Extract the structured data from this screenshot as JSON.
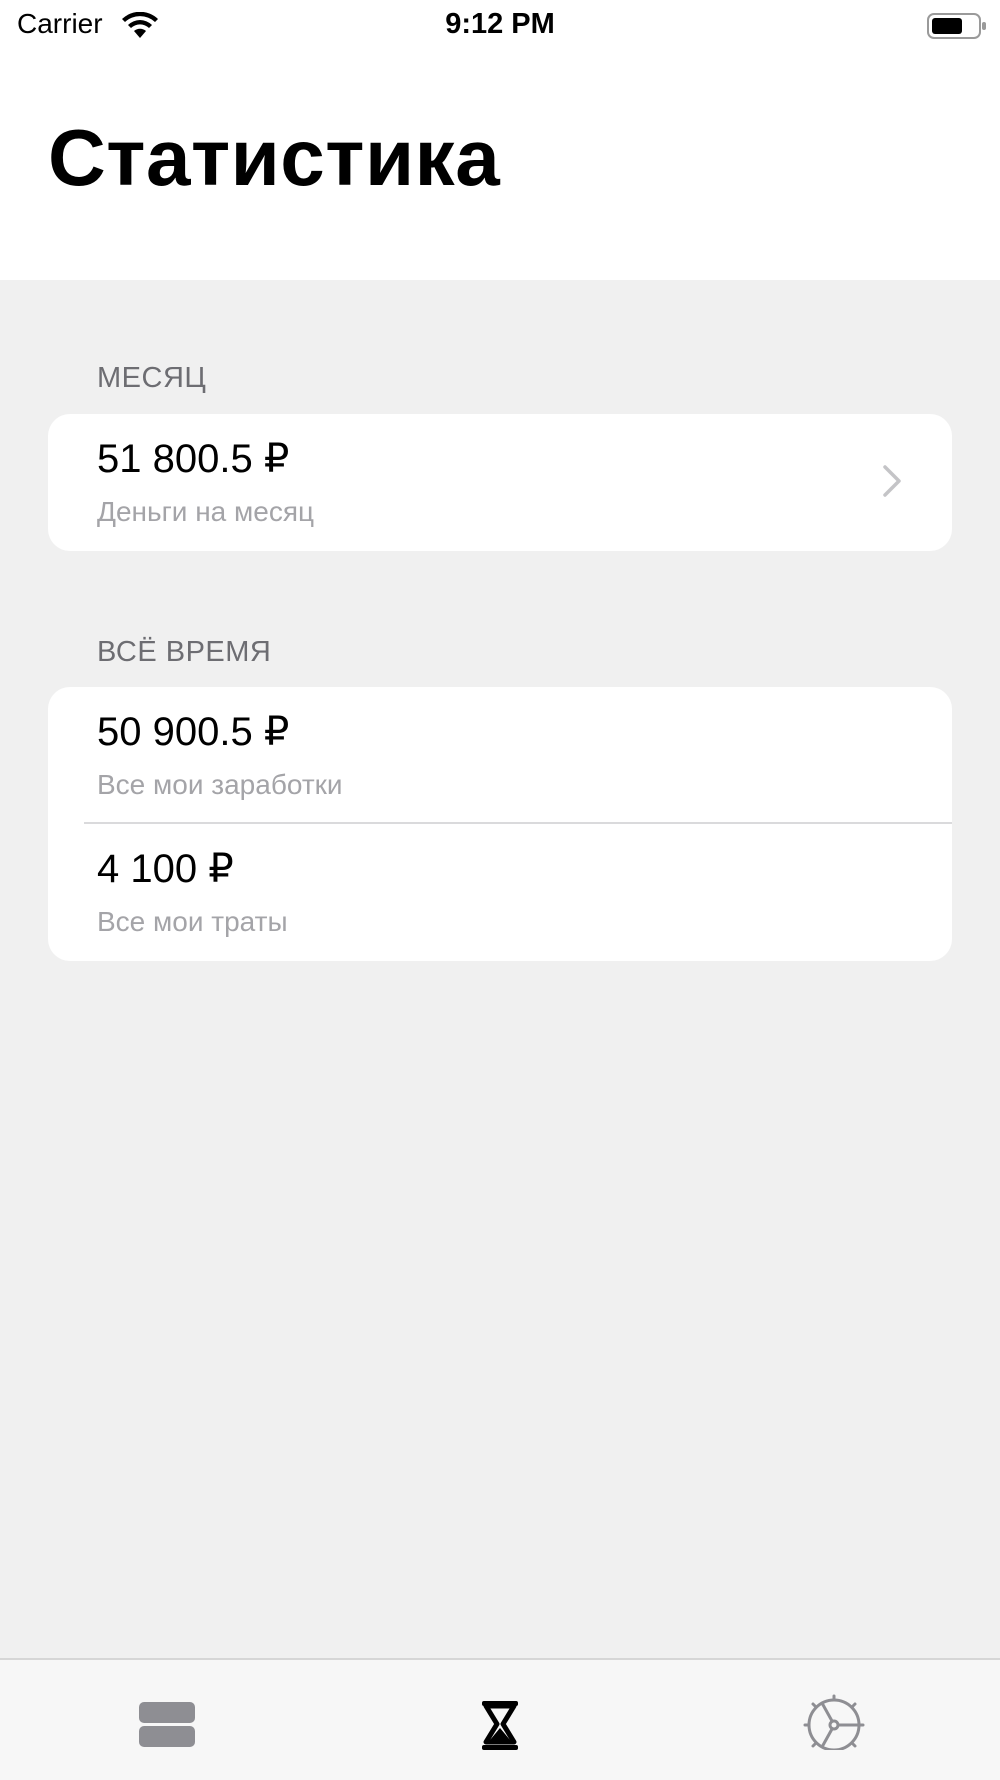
{
  "status_bar": {
    "carrier": "Carrier",
    "time": "9:12 PM",
    "icons": [
      "wifi-icon",
      "battery-icon"
    ]
  },
  "header": {
    "title": "Статистика"
  },
  "sections": {
    "month": {
      "header": "МЕСЯЦ",
      "rows": [
        {
          "value": "51 800.5 ₽",
          "subtitle": "Деньги на месяц",
          "has_chevron": true
        }
      ]
    },
    "all_time": {
      "header": "ВСЁ ВРЕМЯ",
      "rows": [
        {
          "value": "50 900.5 ₽",
          "subtitle": "Все мои заработки"
        },
        {
          "value": "4 100 ₽",
          "subtitle": "Все мои траты"
        }
      ]
    }
  },
  "tab_bar": {
    "tabs": [
      {
        "icon": "stack-icon",
        "selected": false
      },
      {
        "icon": "hourglass-icon",
        "selected": true
      },
      {
        "icon": "gear-icon",
        "selected": false
      }
    ],
    "colors": {
      "selected": "#000000",
      "unselected": "#8e8e93"
    }
  },
  "colors": {
    "background": "#f0f0f0",
    "card": "#ffffff",
    "section_header": "#6d6d72",
    "subtitle": "#a4a4a8"
  }
}
